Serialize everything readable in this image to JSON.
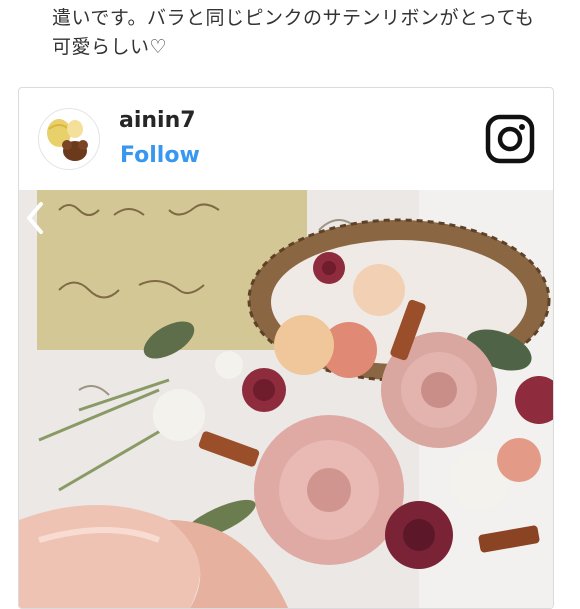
{
  "post": {
    "caption_lines": [
      "遣いです。バラと同じピンクのサテンリボンがとっても",
      "可愛らしい♡"
    ]
  },
  "embed": {
    "username": "ainin7",
    "follow_label": "Follow",
    "icons": {
      "logo": "instagram-icon",
      "prev": "chevron-left-icon",
      "avatar": "profile-avatar"
    },
    "colors": {
      "follow": "#3897f0",
      "border": "#dbdbdb"
    }
  }
}
